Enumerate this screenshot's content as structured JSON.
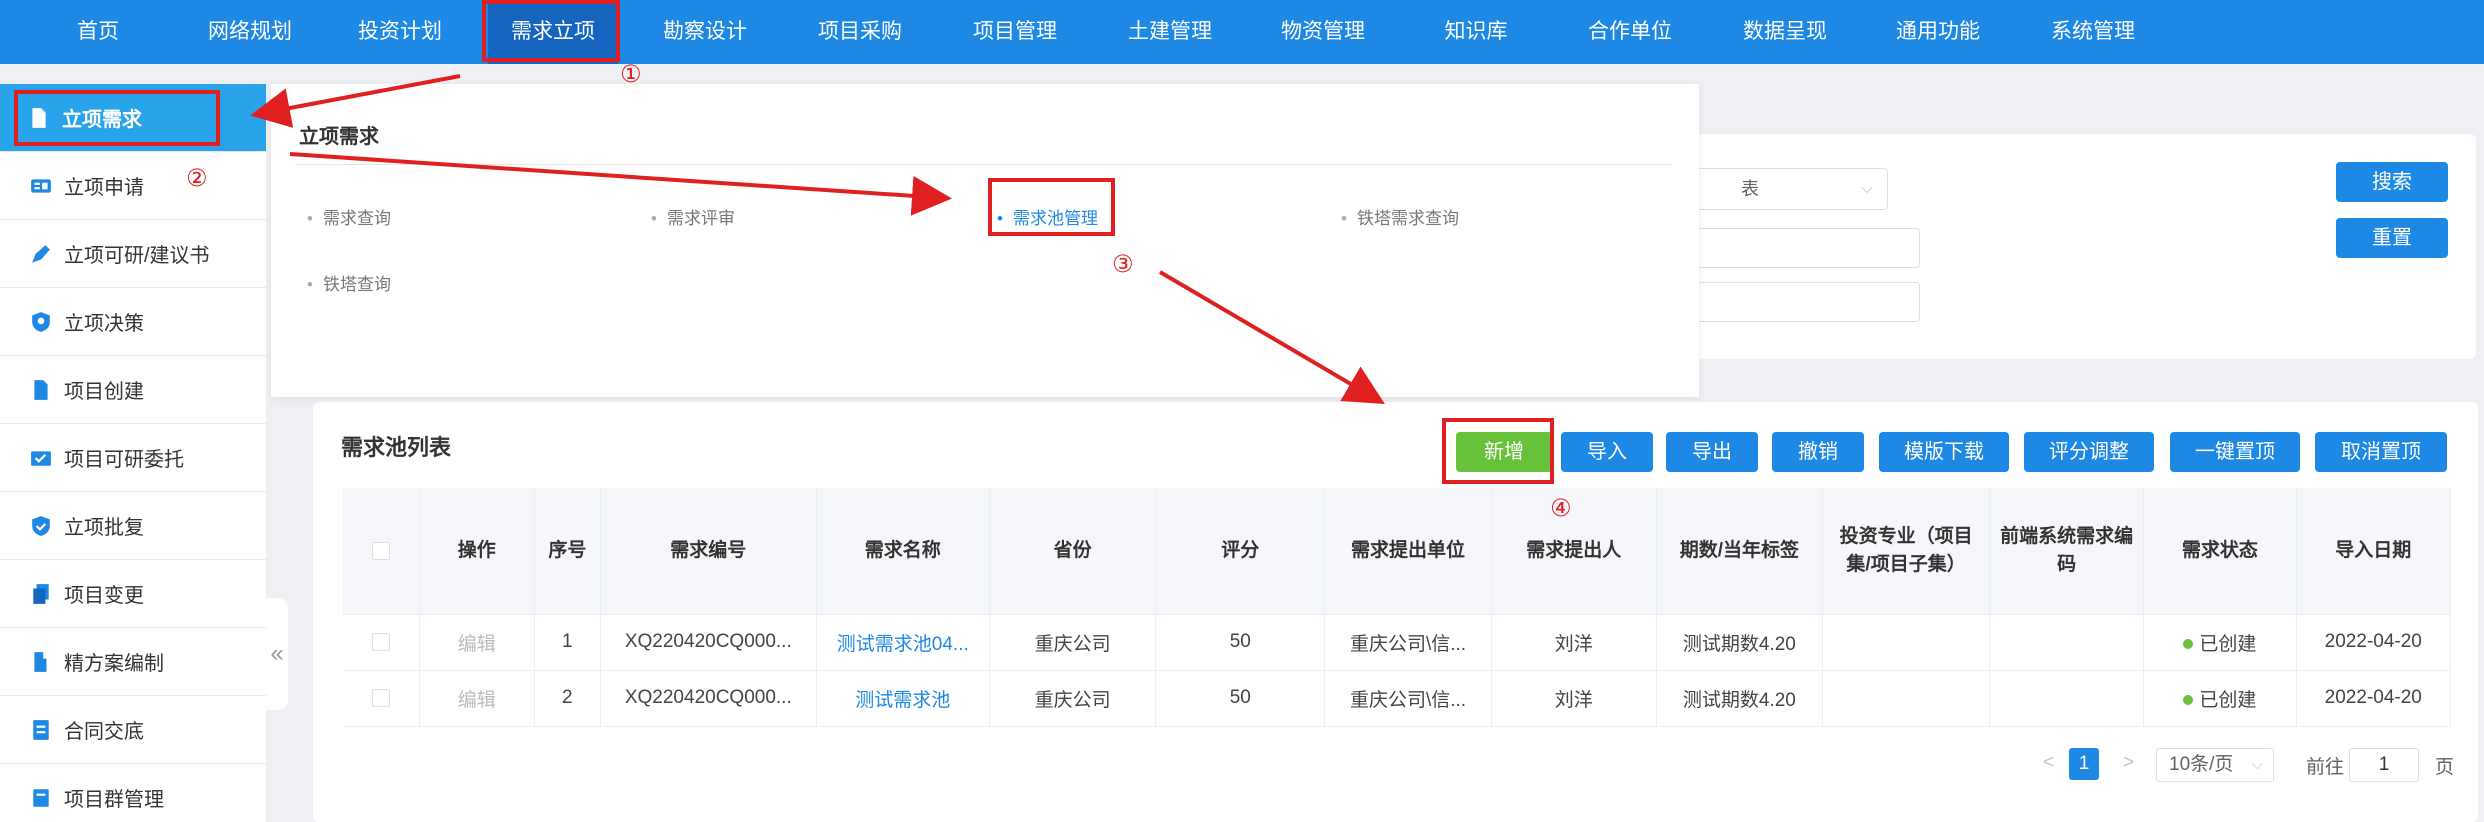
{
  "nav": {
    "items": [
      "首页",
      "网络规划",
      "投资计划",
      "需求立项",
      "勘察设计",
      "项目采购",
      "项目管理",
      "土建管理",
      "物资管理",
      "知识库",
      "合作单位",
      "数据呈现",
      "通用功能",
      "系统管理"
    ],
    "active": "需求立项"
  },
  "sidebar": {
    "items": [
      {
        "label": "立项需求",
        "icon": "document-icon"
      },
      {
        "label": "立项申请",
        "icon": "card-icon"
      },
      {
        "label": "立项可研/建议书",
        "icon": "pen-icon"
      },
      {
        "label": "立项决策",
        "icon": "shield-key-icon"
      },
      {
        "label": "项目创建",
        "icon": "document-icon"
      },
      {
        "label": "项目可研委托",
        "icon": "mail-check-icon"
      },
      {
        "label": "立项批复",
        "icon": "shield-check-icon"
      },
      {
        "label": "项目变更",
        "icon": "copy-icon"
      },
      {
        "label": "精方案编制",
        "icon": "book-icon"
      },
      {
        "label": "合同交底",
        "icon": "list-doc-icon"
      },
      {
        "label": "项目群管理",
        "icon": "stack-icon"
      }
    ],
    "collapse_glyph": "«"
  },
  "menu": {
    "title": "立项需求",
    "links": [
      "需求查询",
      "需求评审",
      "需求池管理",
      "铁塔需求查询",
      "铁塔查询"
    ],
    "dot": "•"
  },
  "search": {
    "select_value": "表",
    "search_label": "搜索",
    "reset_label": "重置"
  },
  "list": {
    "title": "需求池列表",
    "toolbar": [
      "新增",
      "导入",
      "导出",
      "撤销",
      "模版下载",
      "评分调整",
      "一键置顶",
      "取消置顶"
    ],
    "columns": [
      "",
      "操作",
      "序号",
      "需求编号",
      "需求名称",
      "省份",
      "评分",
      "需求提出单位",
      "需求提出人",
      "期数/当年标签",
      "投资专业（项目集/项目子集）",
      "前端系统需求编码",
      "需求状态",
      "导入日期"
    ],
    "rows": [
      {
        "op": "编辑",
        "idx": "1",
        "code": "XQ220420CQ000...",
        "name": "测试需求池04...",
        "province": "重庆公司",
        "score": "50",
        "unit": "重庆公司\\信...",
        "person": "刘洋",
        "period": "测试期数4.20",
        "major": "",
        "frontcode": "",
        "status": "已创建",
        "date": "2022-04-20"
      },
      {
        "op": "编辑",
        "idx": "2",
        "code": "XQ220420CQ000...",
        "name": "测试需求池",
        "province": "重庆公司",
        "score": "50",
        "unit": "重庆公司\\信...",
        "person": "刘洋",
        "period": "测试期数4.20",
        "major": "",
        "frontcode": "",
        "status": "已创建",
        "date": "2022-04-20"
      }
    ]
  },
  "pagination": {
    "prev": "<",
    "current": "1",
    "next": ">",
    "page_size": "10条/页",
    "goto_prefix": "前往",
    "goto_value": "1",
    "goto_suffix": "页"
  },
  "annotations": {
    "labels": [
      "①",
      "②",
      "③",
      "④"
    ],
    "color": "#e02020"
  },
  "colors": {
    "primary": "#1e88e5",
    "sidebar_active": "#29a3ea",
    "success": "#67c23a"
  }
}
